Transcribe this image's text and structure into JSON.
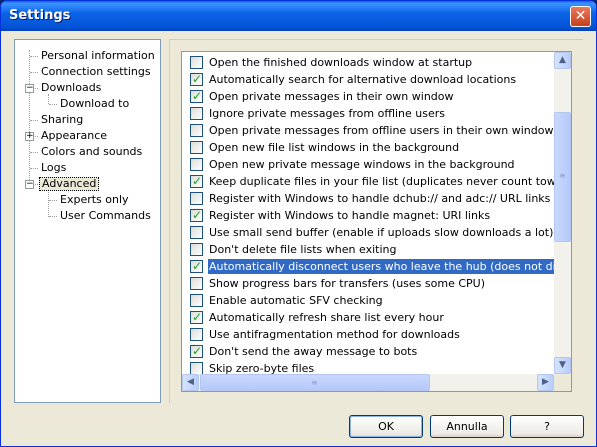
{
  "window": {
    "title": "Settings",
    "close_glyph": "✕"
  },
  "tree": {
    "items": [
      {
        "label": "Personal information"
      },
      {
        "label": "Connection settings"
      },
      {
        "label": "Downloads",
        "expander": "−"
      },
      {
        "label": "Download to"
      },
      {
        "label": "Sharing"
      },
      {
        "label": "Appearance",
        "expander": "+"
      },
      {
        "label": "Colors and sounds"
      },
      {
        "label": "Logs"
      },
      {
        "label": "Advanced",
        "expander": "−",
        "selected": true
      },
      {
        "label": "Experts only"
      },
      {
        "label": "User Commands"
      }
    ]
  },
  "options": [
    {
      "label": "Open the finished downloads window at startup",
      "checked": false
    },
    {
      "label": "Automatically search for alternative download locations",
      "checked": true
    },
    {
      "label": "Open private messages in their own window",
      "checked": true
    },
    {
      "label": "Ignore private messages from offline users",
      "checked": false
    },
    {
      "label": "Open private messages from offline users in their own window",
      "checked": false
    },
    {
      "label": "Open new file list windows in the background",
      "checked": false
    },
    {
      "label": "Open new private message windows in the background",
      "checked": false
    },
    {
      "label": "Keep duplicate files in your file list (duplicates never count towards your sh",
      "checked": true
    },
    {
      "label": "Register with Windows to handle dchub:// and adc:// URL links",
      "checked": false
    },
    {
      "label": "Register with Windows to handle magnet: URI links",
      "checked": true
    },
    {
      "label": "Use small send buffer (enable if uploads slow downloads a lot)",
      "checked": false
    },
    {
      "label": "Don't delete file lists when exiting",
      "checked": false
    },
    {
      "label": "Automatically disconnect users who leave the hub (does not disconnect w",
      "checked": true,
      "highlighted": true
    },
    {
      "label": "Show progress bars for transfers (uses some CPU)",
      "checked": false
    },
    {
      "label": "Enable automatic SFV checking",
      "checked": false
    },
    {
      "label": "Automatically refresh share list every hour",
      "checked": true
    },
    {
      "label": "Use antifragmentation method for downloads",
      "checked": false
    },
    {
      "label": "Don't send the away message to bots",
      "checked": true
    },
    {
      "label": "Skip zero-byte files",
      "checked": false
    }
  ],
  "scroll": {
    "up": "▲",
    "down": "▼",
    "left": "◀",
    "right": "▶",
    "grip": "≡"
  },
  "buttons": {
    "ok": "OK",
    "cancel": "Annulla",
    "help": "?"
  },
  "colors": {
    "selection": "#316ac5",
    "titlebar": "#0453d6",
    "check": "#21a121"
  }
}
